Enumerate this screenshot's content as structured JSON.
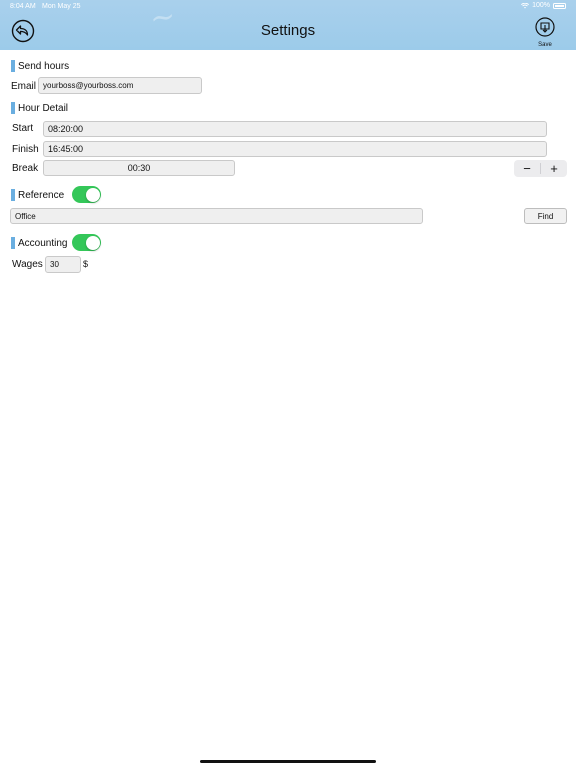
{
  "status_bar": {
    "time": "8:04 AM",
    "date": "Mon May 25",
    "battery": "100%"
  },
  "header": {
    "title": "Settings",
    "save_label": "Save"
  },
  "send_hours": {
    "heading": "Send hours",
    "email_label": "Email",
    "email_value": "yourboss@yourboss.com"
  },
  "hour_detail": {
    "heading": "Hour Detail",
    "start_label": "Start",
    "start_value": "08:20:00",
    "finish_label": "Finish",
    "finish_value": "16:45:00",
    "break_label": "Break",
    "break_value": "00:30",
    "stepper_minus": "−",
    "stepper_plus": "+"
  },
  "reference": {
    "heading": "Reference",
    "enabled": true,
    "value": "Office",
    "find_label": "Find"
  },
  "accounting": {
    "heading": "Accounting",
    "enabled": true,
    "wages_label": "Wages",
    "wages_value": "30",
    "currency": "$"
  },
  "colors": {
    "accent": "#6aaee0",
    "toggle_on": "#34c759",
    "header_bg": "#9ccbea"
  },
  "icons": {
    "back": "back-arrow-circle-icon",
    "save": "save-tray-icon"
  }
}
